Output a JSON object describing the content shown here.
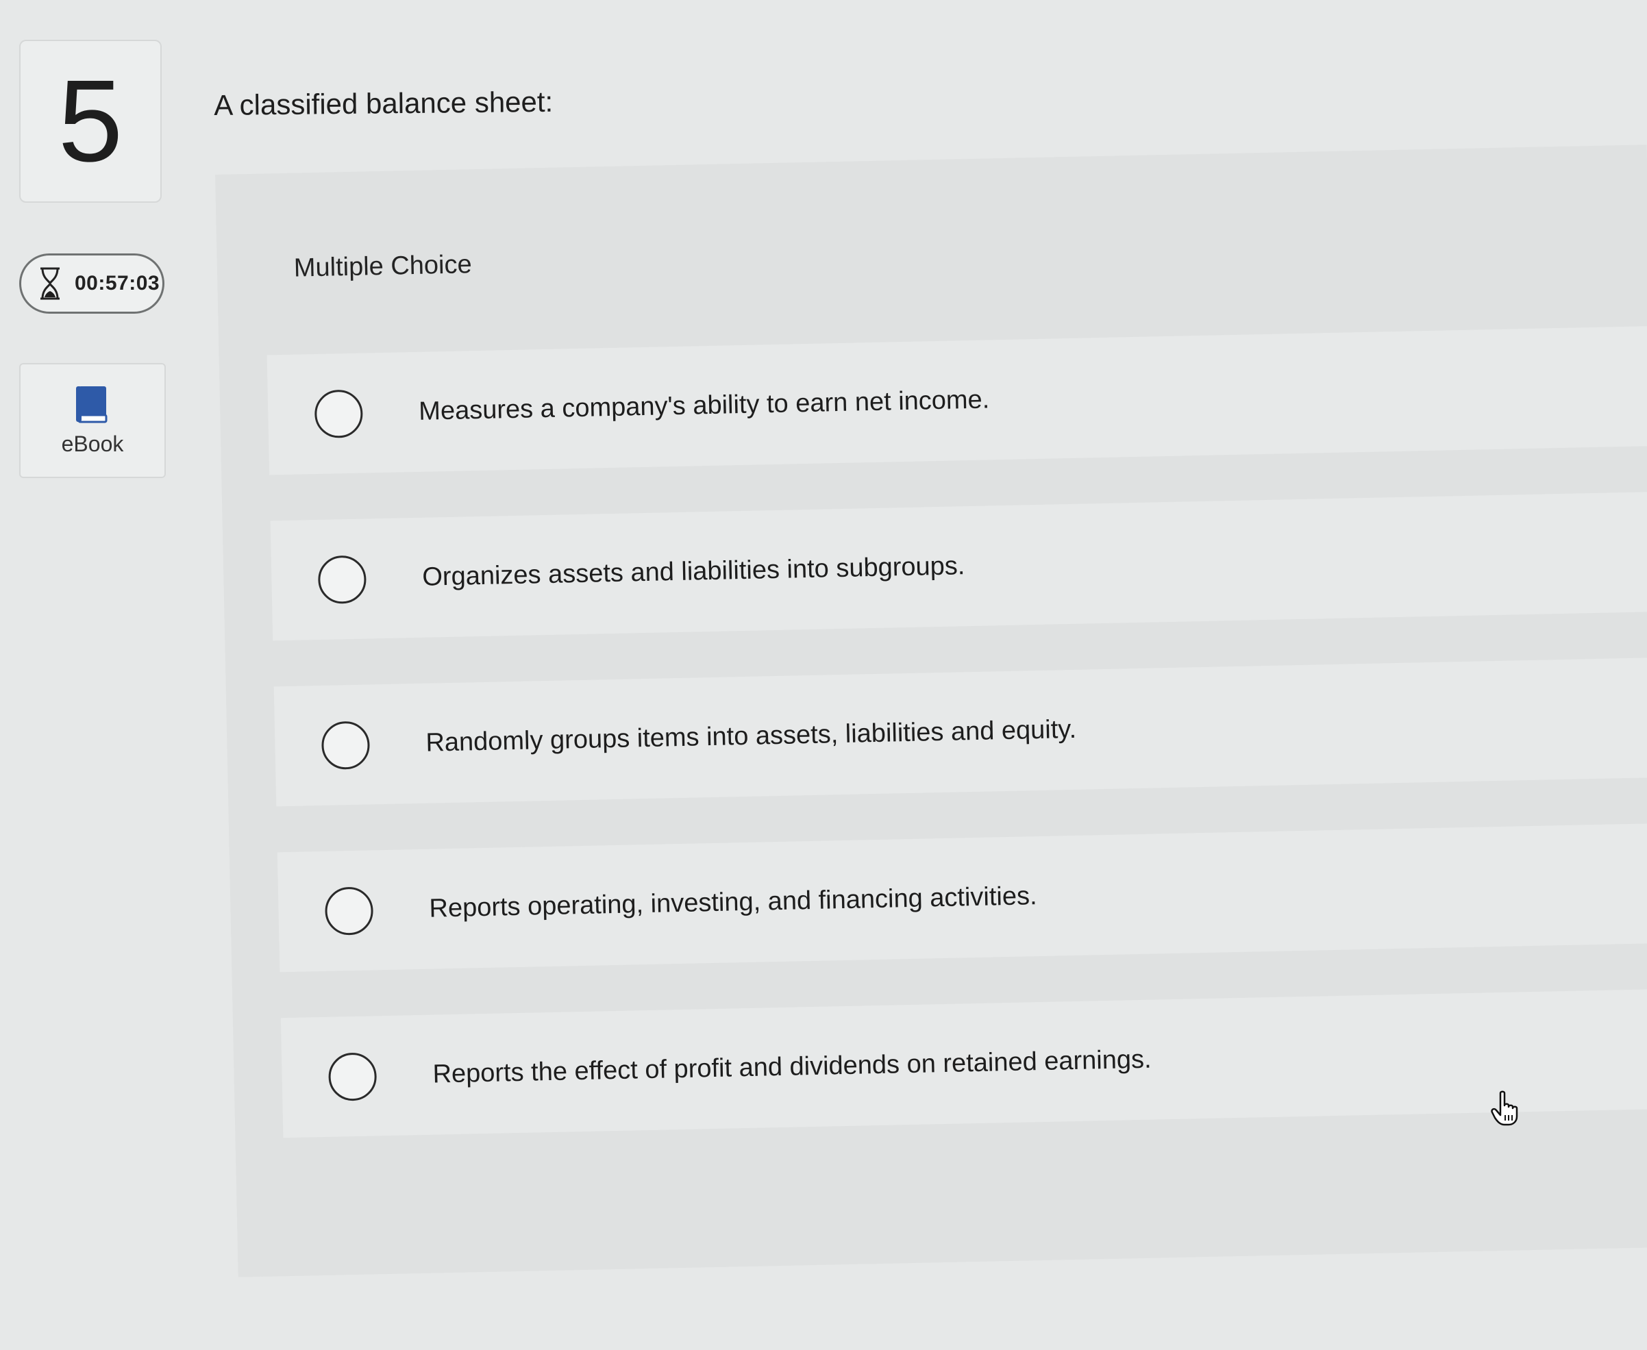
{
  "question": {
    "number": "5",
    "text": "A classified balance sheet:"
  },
  "timer": {
    "value": "00:57:03",
    "icon": "hourglass-icon"
  },
  "ebook": {
    "label": "eBook",
    "icon": "book-icon"
  },
  "panel": {
    "type_label": "Multiple Choice"
  },
  "options": [
    {
      "text": "Measures a company's ability to earn net income."
    },
    {
      "text": "Organizes assets and liabilities into subgroups."
    },
    {
      "text": "Randomly groups items into assets, liabilities and equity."
    },
    {
      "text": "Reports operating, investing, and financing activities."
    },
    {
      "text": "Reports the effect of profit and dividends on retained earnings."
    }
  ],
  "colors": {
    "background": "#e6e8e8",
    "panel": "#dfe1e1",
    "option": "#e7e9e9",
    "ebook_blue": "#2e5aa8"
  }
}
